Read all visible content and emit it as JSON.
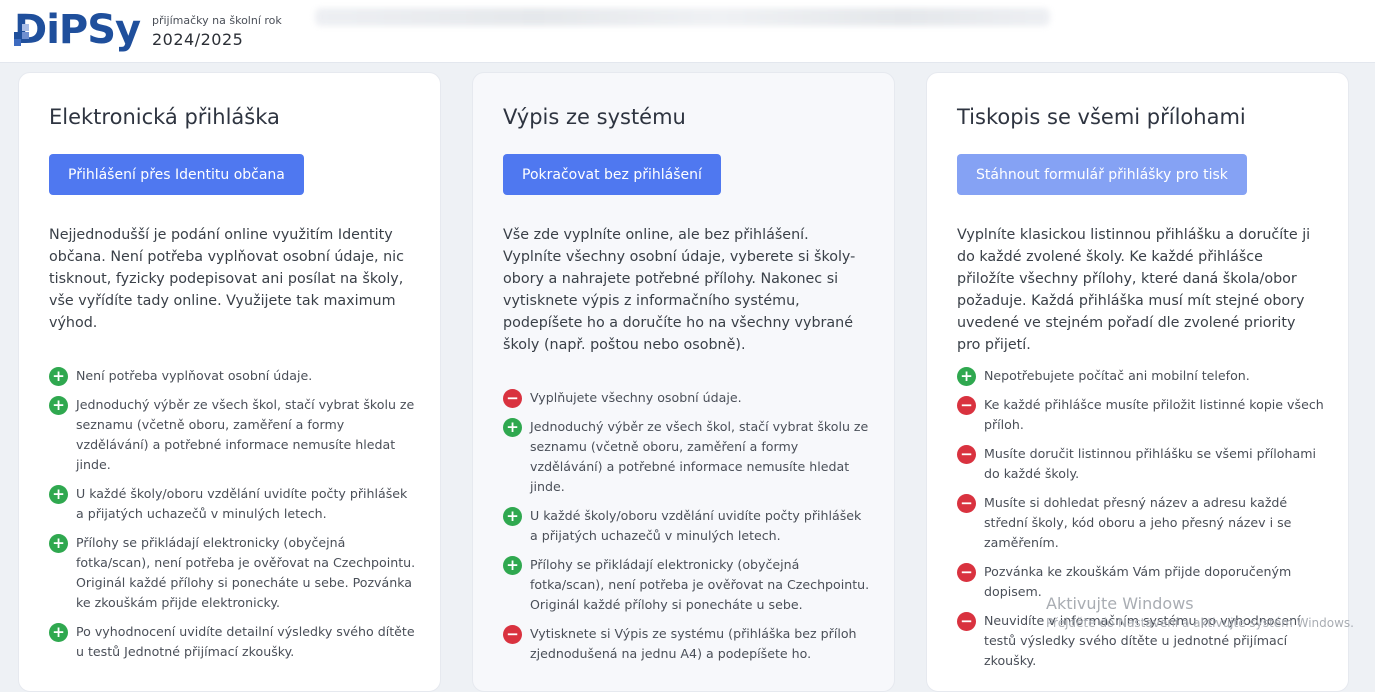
{
  "header": {
    "logo_text": "DiPSy",
    "subtitle": "přijímačky na školní rok",
    "year": "2024/2025"
  },
  "cards": [
    {
      "title": "Elektronická přihláška",
      "button": "Přihlášení přes Identitu občana",
      "description": "Nejjednodušší je podání online využitím Identity občana. Není potřeba vyplňovat osobní údaje, nic tisknout, fyzicky podepisovat ani posílat na školy, vše vyřídíte tady online. Využijete tak maximum výhod.",
      "items": [
        {
          "type": "plus",
          "text": "Není potřeba vyplňovat osobní údaje."
        },
        {
          "type": "plus",
          "text": "Jednoduchý výběr ze všech škol, stačí vybrat školu ze seznamu (včetně oboru, zaměření a formy vzdělávání) a potřebné informace nemusíte hledat jinde."
        },
        {
          "type": "plus",
          "text": "U každé školy/oboru vzdělání uvidíte počty přihlášek a přijatých uchazečů v minulých letech."
        },
        {
          "type": "plus",
          "text": "Přílohy se přikládají elektronicky (obyčejná fotka/scan), není potřeba je ověřovat na Czechpointu. Originál každé přílohy si ponecháte u sebe. Pozvánka ke zkouškám přijde elektronicky."
        },
        {
          "type": "plus",
          "text": "Po vyhodnocení uvidíte detailní výsledky svého dítěte u testů Jednotné přijímací zkoušky."
        }
      ]
    },
    {
      "title": "Výpis ze systému",
      "button": "Pokračovat bez přihlášení",
      "description": "Vše zde vyplníte online, ale bez přihlášení. Vyplníte všechny osobní údaje, vyberete si školy-obory a nahrajete potřebné přílohy. Nakonec si vytisknete výpis z informačního systému, podepíšete ho a doručíte ho na všechny vybrané školy (např. poštou nebo osobně).",
      "items": [
        {
          "type": "minus",
          "text": "Vyplňujete všechny osobní údaje."
        },
        {
          "type": "plus",
          "text": "Jednoduchý výběr ze všech škol, stačí vybrat školu ze seznamu (včetně oboru, zaměření a formy vzdělávání) a potřebné informace nemusíte hledat jinde."
        },
        {
          "type": "plus",
          "text": "U každé školy/oboru vzdělání uvidíte počty přihlášek a přijatých uchazečů v minulých letech."
        },
        {
          "type": "plus",
          "text": "Přílohy se přikládají elektronicky (obyčejná fotka/scan), není potřeba je ověřovat na Czechpointu. Originál každé přílohy si ponecháte u sebe."
        },
        {
          "type": "minus",
          "text": "Vytisknete si Výpis ze systému (přihláška bez příloh zjednodušená na jednu A4) a podepíšete ho."
        }
      ]
    },
    {
      "title": "Tiskopis se všemi přílohami",
      "button": "Stáhnout formulář přihlášky pro tisk",
      "description": "Vyplníte klasickou listinnou přihlášku a doručíte ji do každé zvolené školy. Ke každé přihlášce přiložíte všechny přílohy, které daná škola/obor požaduje. Každá přihláška musí mít stejné obory uvedené ve stejném pořadí dle zvolené priority pro přijetí.",
      "items": [
        {
          "type": "plus",
          "text": "Nepotřebujete počítač ani mobilní telefon."
        },
        {
          "type": "minus",
          "text": "Ke každé přihlášce musíte přiložit listinné kopie všech příloh."
        },
        {
          "type": "minus",
          "text": "Musíte doručit listinnou přihlášku se všemi přílohami do každé školy."
        },
        {
          "type": "minus",
          "text": "Musíte si dohledat přesný název a adresu každé střední školy, kód oboru a jeho přesný název i se zaměřením."
        },
        {
          "type": "minus",
          "text": "Pozvánka ke zkouškám Vám přijde doporučeným dopisem."
        },
        {
          "type": "minus",
          "text": "Neuvidíte v informačním systému po vyhodnocení testů výsledky svého dítěte u jednotné přijímací zkoušky."
        }
      ]
    }
  ],
  "watermark": {
    "line1": "Aktivujte Windows",
    "line2": "Přejděte do Nastavení a aktivujte systém Windows."
  }
}
